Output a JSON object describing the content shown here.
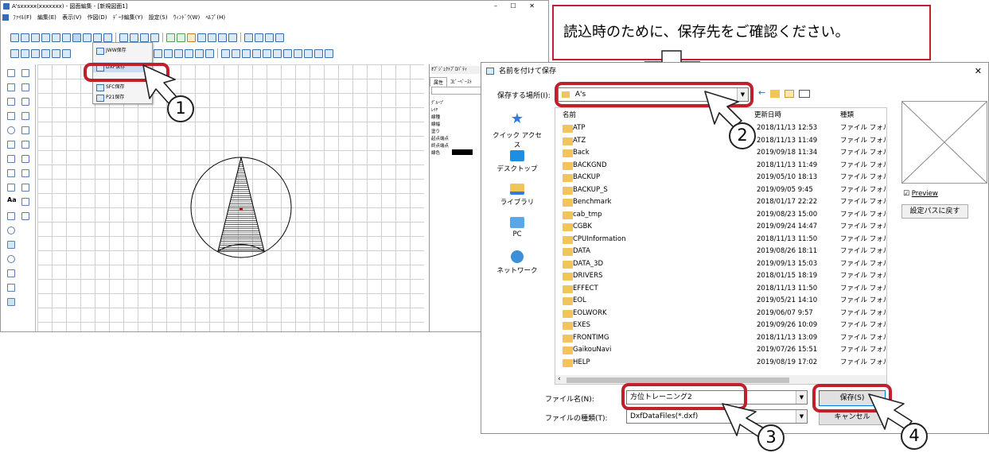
{
  "main_window": {
    "title": "A'sxxxxx(xxxxxxx) - 図面編集 - [新規図面1]",
    "win_controls": [
      "–",
      "☐",
      "✕"
    ],
    "menu": [
      "ﾌｧｲﾙ(F)",
      "編集(E)",
      "表示(V)",
      "作図(D)",
      "ﾃﾞｰﾀ編集(Y)",
      "設定(S)",
      "ｳｨﾝﾄﾞｳ(W)",
      "ﾍﾙﾌﾟ(H)"
    ],
    "save_menu": {
      "items": [
        "JWW保存",
        "DXF保存",
        "SFC保存",
        "P21保存"
      ]
    },
    "property_panel": {
      "title": "ｵﾌﾞｼﾞｪｸﾄﾌﾟﾛﾊﾟﾃｨ",
      "tabs": [
        "属性",
        "ｺﾋﾟｰﾍﾟｰｽﾄ"
      ],
      "fields": [
        "ｸﾞﾙｰﾌﾟ",
        "ﾚｲﾔ",
        "線種",
        "線幅",
        "塗り",
        "起点端点",
        "終点端点",
        "線色"
      ]
    }
  },
  "callout": {
    "text": "読込時のために、保存先をご確認ください。"
  },
  "steps": [
    "1",
    "2",
    "3",
    "4"
  ],
  "dialog": {
    "title": "名前を付けて保存",
    "close_icon": "✕",
    "location_label": "保存する場所(I):",
    "location_value": "A's",
    "sidebar": [
      "クイック アクセス",
      "デスクトップ",
      "ライブラリ",
      "PC",
      "ネットワーク"
    ],
    "columns": [
      "名前",
      "更新日時",
      "種類"
    ],
    "files": [
      {
        "name": "ATP",
        "date": "2018/11/13 12:53",
        "type": "ファイル フォル"
      },
      {
        "name": "ATZ",
        "date": "2018/11/13 11:49",
        "type": "ファイル フォル"
      },
      {
        "name": "Back",
        "date": "2019/09/18 11:34",
        "type": "ファイル フォル"
      },
      {
        "name": "BACKGND",
        "date": "2018/11/13 11:49",
        "type": "ファイル フォル"
      },
      {
        "name": "BACKUP",
        "date": "2019/05/10 18:13",
        "type": "ファイル フォル"
      },
      {
        "name": "BACKUP_S",
        "date": "2019/09/05 9:45",
        "type": "ファイル フォル"
      },
      {
        "name": "Benchmark",
        "date": "2018/01/17 22:22",
        "type": "ファイル フォル"
      },
      {
        "name": "cab_tmp",
        "date": "2019/08/23 15:00",
        "type": "ファイル フォル"
      },
      {
        "name": "CGBK",
        "date": "2019/09/24 14:47",
        "type": "ファイル フォル"
      },
      {
        "name": "CPUInformation",
        "date": "2018/11/13 11:50",
        "type": "ファイル フォル"
      },
      {
        "name": "DATA",
        "date": "2019/08/26 18:11",
        "type": "ファイル フォル"
      },
      {
        "name": "DATA_3D",
        "date": "2019/09/13 15:03",
        "type": "ファイル フォル"
      },
      {
        "name": "DRIVERS",
        "date": "2018/01/15 18:19",
        "type": "ファイル フォル"
      },
      {
        "name": "EFFECT",
        "date": "2018/11/13 11:50",
        "type": "ファイル フォル"
      },
      {
        "name": "EOL",
        "date": "2019/05/21 14:10",
        "type": "ファイル フォル"
      },
      {
        "name": "EOLWORK",
        "date": "2019/06/07 9:57",
        "type": "ファイル フォル"
      },
      {
        "name": "EXES",
        "date": "2019/09/26 10:09",
        "type": "ファイル フォル"
      },
      {
        "name": "FRONTIMG",
        "date": "2018/11/13 13:09",
        "type": "ファイル フォル"
      },
      {
        "name": "GaikouNavi",
        "date": "2019/07/26 15:51",
        "type": "ファイル フォル"
      },
      {
        "name": "HELP",
        "date": "2019/08/19 17:02",
        "type": "ファイル フォル"
      }
    ],
    "preview_label": "Preview",
    "reset_path_button": "設定パスに戻す",
    "filename_label": "ファイル名(N):",
    "filename_value": "方位トレーニング2",
    "filetype_label": "ファイルの種類(T):",
    "filetype_value": "DxfDataFiles(*.dxf)",
    "save_button": "保存(S)",
    "cancel_button": "キャンセル"
  }
}
